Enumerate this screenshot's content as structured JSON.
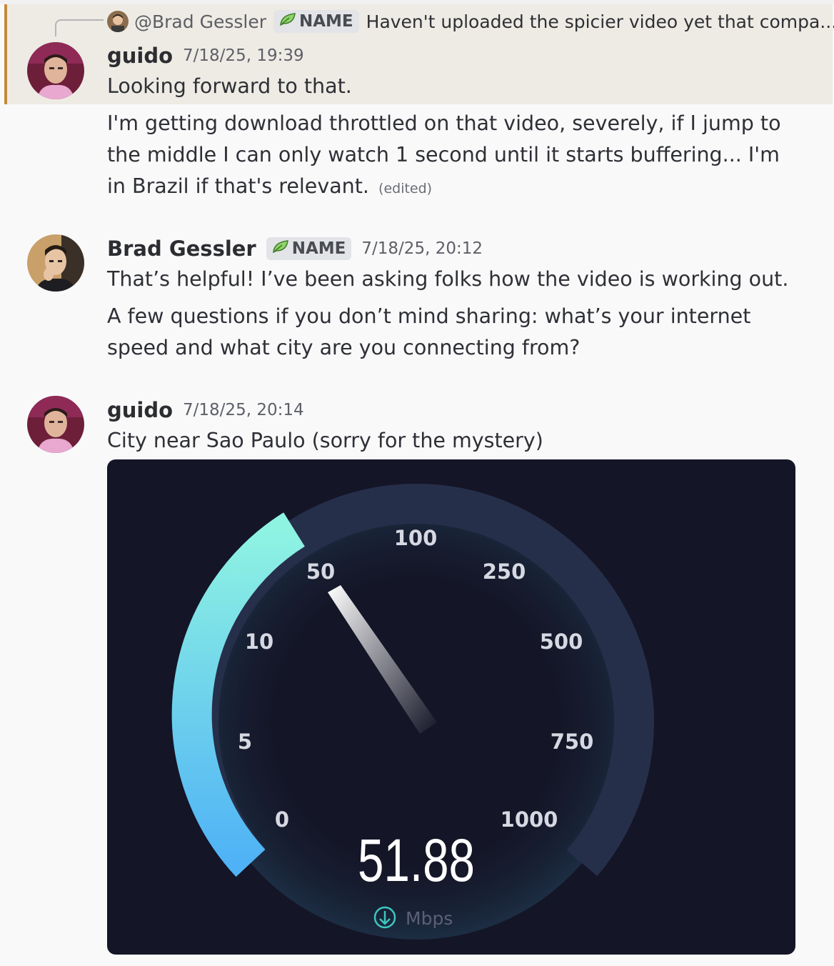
{
  "reply": {
    "author": "@Brad Gessler",
    "tag": "NAME",
    "preview": "Haven't uploaded the spicier video yet that compa..."
  },
  "messages": [
    {
      "author": "guido",
      "timestamp": "7/18/25, 19:39",
      "lines": [
        "Looking forward to that."
      ]
    },
    {
      "lines": [
        "I'm getting download throttled on that video, severely, if I jump to the middle I can only watch 1 second until it starts buffering... I'm in Brazil if that's relevant."
      ],
      "edited_label": "(edited)"
    },
    {
      "author": "Brad Gessler",
      "tag": "NAME",
      "timestamp": "7/18/25, 20:12",
      "lines": [
        "That’s helpful! I’ve been asking folks how the video is working out.",
        "A few questions if you don’t mind sharing: what’s your internet speed and what city are you connecting from?"
      ]
    },
    {
      "author": "guido",
      "timestamp": "7/18/25, 20:14",
      "lines": [
        "City near Sao Paulo (sorry for the mystery)"
      ]
    }
  ],
  "speedtest": {
    "value": "51.88",
    "unit": "Mbps",
    "ticks": [
      "0",
      "5",
      "10",
      "50",
      "100",
      "250",
      "500",
      "750",
      "1000"
    ]
  },
  "colors": {
    "accent_bar": "#c48a3a",
    "gauge_fill_top": "#8ff3e2",
    "gauge_fill_bottom": "#4fb2f6",
    "gauge_track": "#262f4a",
    "embed_bg": "#141526"
  },
  "icons": {
    "tag_icon": "leaf-icon",
    "unit_icon": "download-arrow-icon"
  }
}
